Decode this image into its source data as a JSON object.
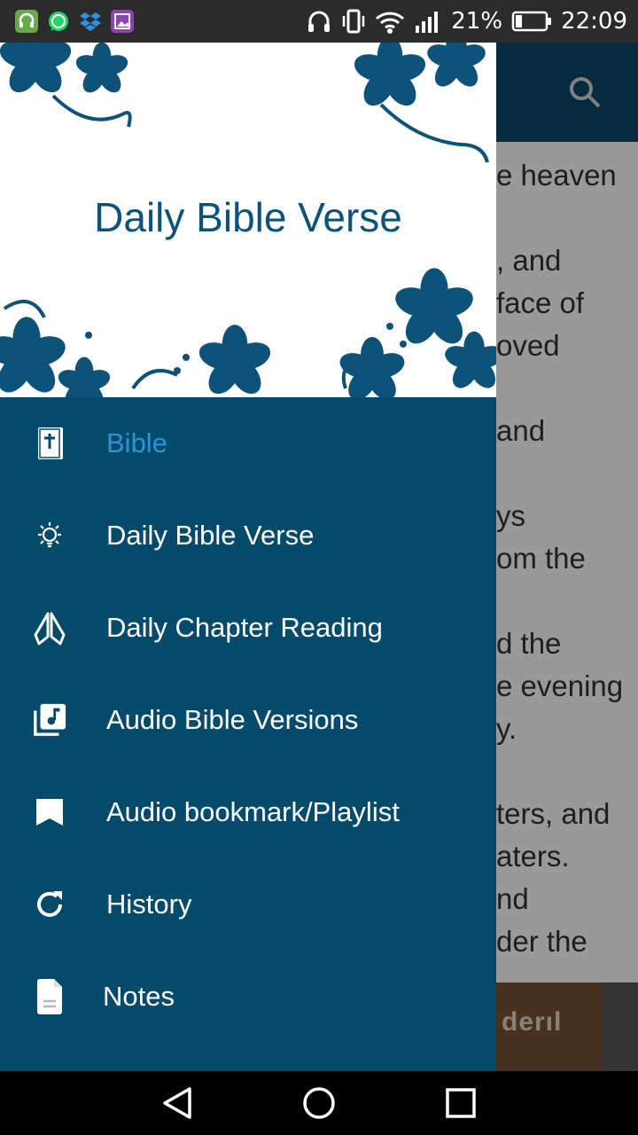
{
  "status_bar": {
    "battery_percent": "21%",
    "time": "22:09",
    "apps": [
      "headset-app-icon",
      "whatsapp-icon",
      "dropbox-icon",
      "gallery-icon"
    ],
    "colors": {
      "headset": "#6aa84f",
      "whatsapp": "#25d366",
      "dropbox": "#2f8fe0",
      "gallery": "#8e44ad"
    }
  },
  "background_screen": {
    "text_fragments": [
      "e heaven",
      "",
      ", and",
      "face of",
      "oved",
      "",
      "and",
      "",
      "ys",
      "om the",
      "",
      "d the",
      "e evening",
      "y.",
      "",
      "ters, and",
      "aters.",
      "nd",
      "der the"
    ],
    "ad_text": "derıl"
  },
  "drawer": {
    "header_title": "Daily Bible Verse",
    "items": [
      {
        "label": "Bible",
        "icon": "bible-icon"
      },
      {
        "label": "Daily Bible Verse",
        "icon": "lightbulb-icon"
      },
      {
        "label": "Daily Chapter Reading",
        "icon": "praying-hands-icon"
      },
      {
        "label": "Audio Bible Versions",
        "icon": "music-library-icon"
      },
      {
        "label": "Audio bookmark/Playlist",
        "icon": "bookmark-icon"
      },
      {
        "label": "History",
        "icon": "refresh-icon"
      },
      {
        "label": "Notes",
        "icon": "note-icon"
      }
    ]
  },
  "theme": {
    "primary": "#044a6b",
    "accent": "#2a94d6",
    "header_text": "#0d5278"
  }
}
